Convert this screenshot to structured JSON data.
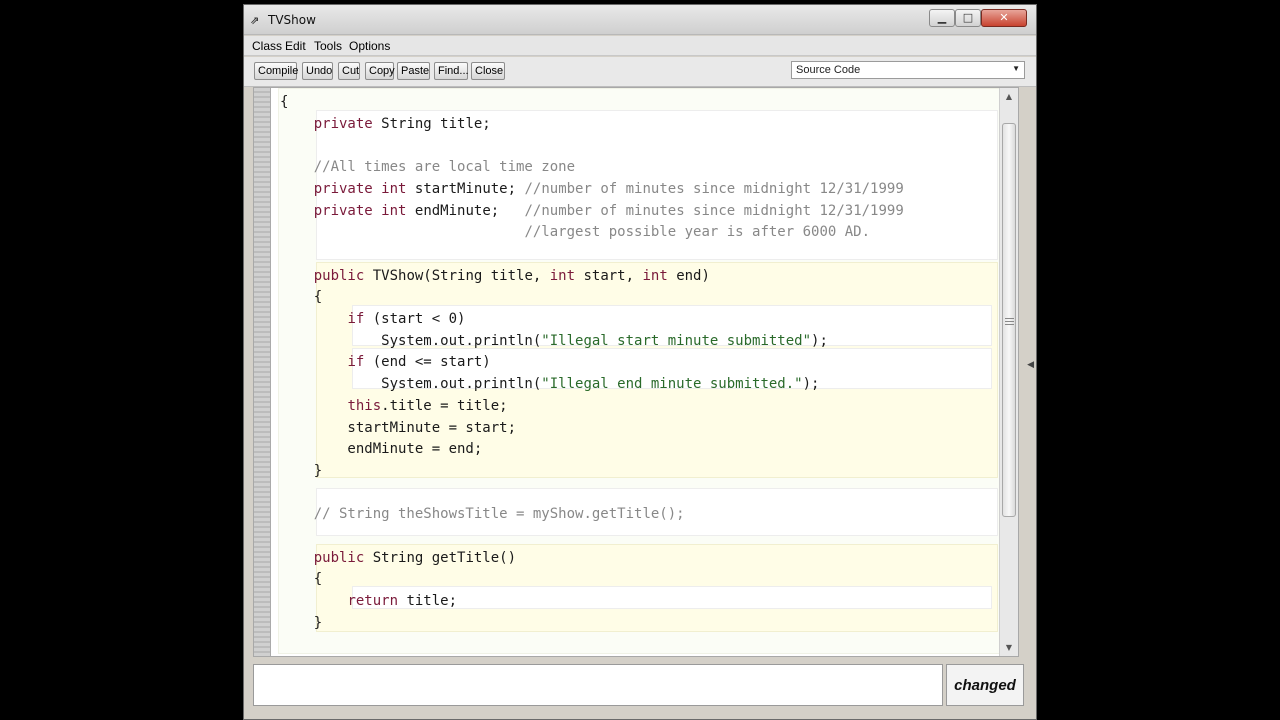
{
  "window": {
    "title": "TVShow",
    "app_icon": "bluej-icon",
    "controls": {
      "minimize": "▁",
      "maximize": "□",
      "close": "✕"
    }
  },
  "menu": [
    "Class",
    "Edit",
    "Tools",
    "Options"
  ],
  "toolbar": {
    "buttons": [
      "Compile",
      "Undo",
      "Cut",
      "Copy",
      "Paste",
      "Find...",
      "Close"
    ],
    "view_select": "Source Code"
  },
  "code": {
    "lines": [
      "{",
      "    private String title;",
      "",
      "    //All times are local time zone",
      "    private int startMinute; //number of minutes since midnight 12/31/1999",
      "    private int endMinute;   //number of minutes since midnight 12/31/1999",
      "                             //largest possible year is after 6000 AD.",
      "",
      "    public TVShow(String title, int start, int end)",
      "    {",
      "        if (start < 0)",
      "            System.out.println(\"Illegal start minute submitted\");",
      "        if (end <= start)",
      "            System.out.println(\"Illegal end minute submitted.\");",
      "        this.title = title;",
      "        startMinute = start;",
      "        endMinute = end;",
      "    }",
      "",
      "    // String theShowsTitle = myShow.getTitle();",
      "",
      "    public String getTitle()",
      "    {",
      "        return title;",
      "    }"
    ]
  },
  "status": {
    "message": "",
    "changed_label": "changed"
  },
  "colors": {
    "keyword": "#7a1a3a",
    "comment": "#888888",
    "string": "#2a6a2a",
    "scope_highlight": "#fffde7"
  }
}
